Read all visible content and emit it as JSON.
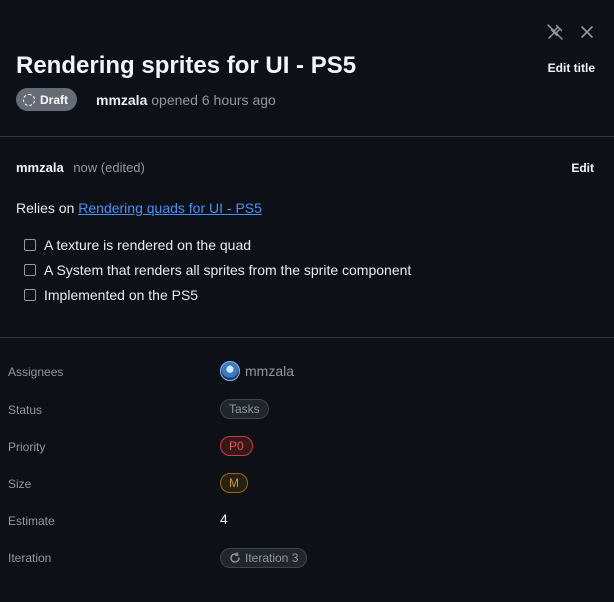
{
  "header": {
    "title": "Rendering sprites for UI - PS5",
    "edit_title_label": "Edit title",
    "status_badge": "Draft",
    "author": "mmzala",
    "opened_text": "opened 6 hours ago"
  },
  "top_icons": {
    "unpin": "unpin-icon",
    "close": "close-icon"
  },
  "comment": {
    "author": "mmzala",
    "time": "now (edited)",
    "edit_label": "Edit",
    "relies_prefix": "Relies on",
    "relies_link": "Rendering quads for UI - PS5",
    "tasks": [
      {
        "label": "A texture is rendered on the quad",
        "checked": false
      },
      {
        "label": "A System that renders all sprites from the sprite component",
        "checked": false
      },
      {
        "label": "Implemented on the PS5",
        "checked": false
      }
    ]
  },
  "fields": {
    "assignees": {
      "label": "Assignees",
      "value": "mmzala"
    },
    "status": {
      "label": "Status",
      "value": "Tasks"
    },
    "priority": {
      "label": "Priority",
      "value": "P0"
    },
    "size": {
      "label": "Size",
      "value": "M"
    },
    "estimate": {
      "label": "Estimate",
      "value": "4"
    },
    "iteration": {
      "label": "Iteration",
      "value": "Iteration 3",
      "icon": "iteration-icon"
    }
  },
  "colors": {
    "background": "#0d1117",
    "link": "#4493f8",
    "priority": "#f85149",
    "size": "#d29922",
    "draft": "#656c76"
  }
}
